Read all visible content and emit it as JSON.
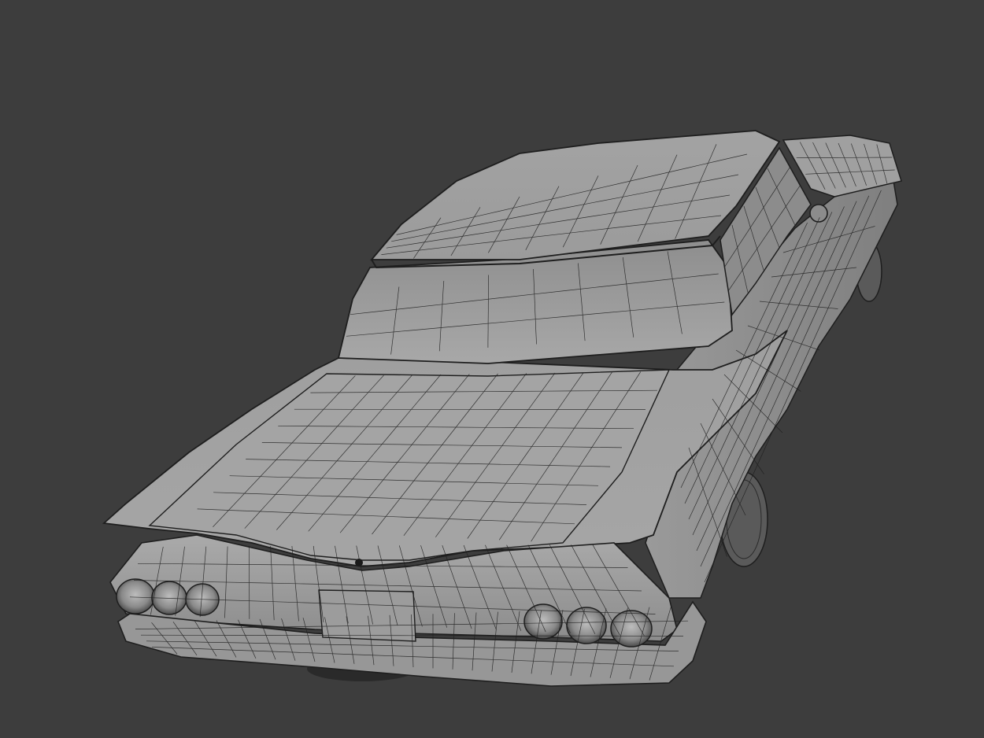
{
  "viewport": {
    "background_color": "#3d3d3d",
    "shading": "solid-wireframe-overlay",
    "colors": {
      "surface_light": "#a9a9a9",
      "surface_mid": "#959595",
      "surface_dark": "#7c7c7c",
      "glass": "#9a9a9a",
      "wire": "#1e1e1e",
      "shadow": "#262626"
    }
  },
  "model": {
    "subject": "car",
    "view": "rear-three-quarter-elevated",
    "display": "wireframe-on-shaded"
  }
}
